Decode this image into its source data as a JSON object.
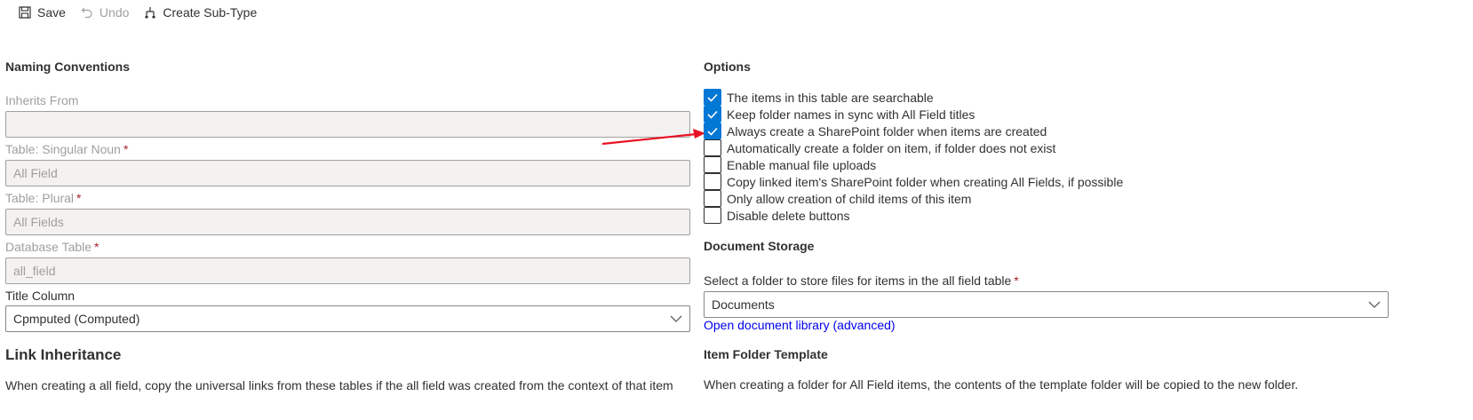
{
  "toolbar": {
    "save_label": "Save",
    "undo_label": "Undo",
    "create_subtype_label": "Create Sub-Type"
  },
  "naming": {
    "title": "Naming Conventions",
    "inherits_from_label": "Inherits From",
    "inherits_from_value": "",
    "singular_label": "Table: Singular Noun",
    "singular_value": "All Field",
    "plural_label": "Table: Plural",
    "plural_value": "All Fields",
    "database_label": "Database Table",
    "database_value": "all_field",
    "required_mark": "*",
    "title_column_label": "Title Column",
    "title_column_value": "Cpmputed (Computed)"
  },
  "link_inheritance": {
    "title": "Link Inheritance",
    "description": "When creating a all field, copy the universal links from these tables if the all field was created from the context of that item"
  },
  "options": {
    "title": "Options",
    "items": [
      {
        "label": "The items in this table are searchable",
        "checked": true
      },
      {
        "label": "Keep folder names in sync with All Field titles",
        "checked": true
      },
      {
        "label": "Always create a SharePoint folder when items are created",
        "checked": true
      },
      {
        "label": "Automatically create a folder on item, if folder does not exist",
        "checked": false
      },
      {
        "label": "Enable manual file uploads",
        "checked": false
      },
      {
        "label": "Copy linked item's SharePoint folder when creating All Fields, if possible",
        "checked": false
      },
      {
        "label": "Only allow creation of child items of this item",
        "checked": false
      },
      {
        "label": "Disable delete buttons",
        "checked": false
      }
    ]
  },
  "document_storage": {
    "title": "Document Storage",
    "folder_label": "Select a folder to store files for items in the all field table",
    "required_mark": "*",
    "folder_value": "Documents",
    "open_library_link": "Open document library (advanced)"
  },
  "item_folder_template": {
    "title": "Item Folder Template",
    "description": "When creating a folder for All Field items, the contents of the template folder will be copied to the new folder."
  },
  "colors": {
    "accent": "#0078d4",
    "link": "#0000ee",
    "required": "#a4262c",
    "annotation_arrow": "#e81123"
  }
}
